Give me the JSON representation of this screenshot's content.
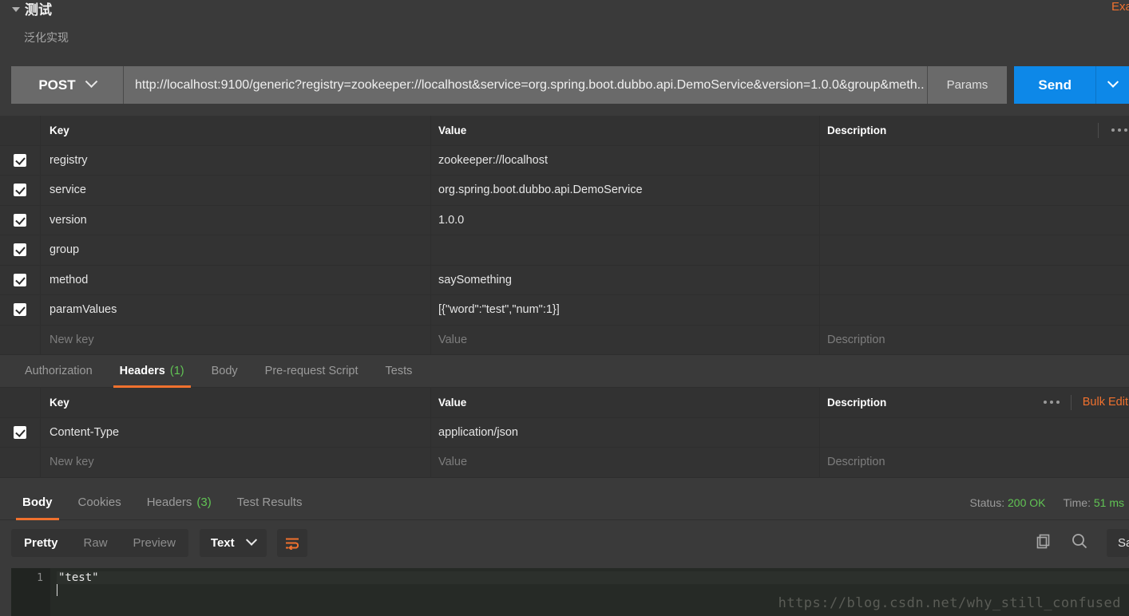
{
  "request": {
    "title": "测试",
    "subtitle": "泛化实现",
    "examples_label": "Examples",
    "method": "POST",
    "url": "http://localhost:9100/generic?registry=zookeeper://localhost&service=org.spring.boot.dubbo.api.DemoService&version=1.0.0&group&meth..",
    "params_button": "Params",
    "send_button": "Send"
  },
  "params_table": {
    "columns": [
      "Key",
      "Value",
      "Description"
    ],
    "rows": [
      {
        "checked": true,
        "key": "registry",
        "value": "zookeeper://localhost",
        "description": ""
      },
      {
        "checked": true,
        "key": "service",
        "value": "org.spring.boot.dubbo.api.DemoService",
        "description": ""
      },
      {
        "checked": true,
        "key": "version",
        "value": "1.0.0",
        "description": ""
      },
      {
        "checked": true,
        "key": "group",
        "value": "",
        "description": ""
      },
      {
        "checked": true,
        "key": "method",
        "value": "saySomething",
        "description": ""
      },
      {
        "checked": true,
        "key": "paramValues",
        "value": "[{\"word\":\"test\",\"num\":1}]",
        "description": ""
      }
    ],
    "new_row": {
      "key_placeholder": "New key",
      "value_placeholder": "Value",
      "description_placeholder": "Description"
    }
  },
  "request_tabs": [
    {
      "label": "Authorization",
      "count": "",
      "active": false
    },
    {
      "label": "Headers",
      "count": "(1)",
      "active": true
    },
    {
      "label": "Body",
      "count": "",
      "active": false
    },
    {
      "label": "Pre-request Script",
      "count": "",
      "active": false
    },
    {
      "label": "Tests",
      "count": "",
      "active": false
    }
  ],
  "headers_table": {
    "columns": [
      "Key",
      "Value",
      "Description"
    ],
    "bulk_edit_label": "Bulk Edit",
    "rows": [
      {
        "checked": true,
        "key": "Content-Type",
        "value": "application/json",
        "description": ""
      }
    ],
    "new_row": {
      "key_placeholder": "New key",
      "value_placeholder": "Value",
      "description_placeholder": "Description"
    }
  },
  "response_tabs": [
    {
      "label": "Body",
      "count": "",
      "active": true
    },
    {
      "label": "Cookies",
      "count": "",
      "active": false
    },
    {
      "label": "Headers",
      "count": "(3)",
      "active": false
    },
    {
      "label": "Test Results",
      "count": "",
      "active": false
    }
  ],
  "response_meta": {
    "status_label": "Status:",
    "status_value": "200 OK",
    "time_label": "Time:",
    "time_value": "51 ms"
  },
  "body_toolbar": {
    "views": [
      {
        "label": "Pretty",
        "active": true
      },
      {
        "label": "Raw",
        "active": false
      },
      {
        "label": "Preview",
        "active": false
      }
    ],
    "format": "Text",
    "save_response_label": "Save Response"
  },
  "response_body": {
    "line_number": "1",
    "content": "\"test\""
  },
  "watermark": "https://blog.csdn.net/why_still_confused",
  "colors": {
    "accent_orange": "#f0712e",
    "send_blue": "#0d88e8",
    "status_green": "#61c454",
    "panel_bg": "#3a3a3a",
    "table_bg": "#333333"
  }
}
